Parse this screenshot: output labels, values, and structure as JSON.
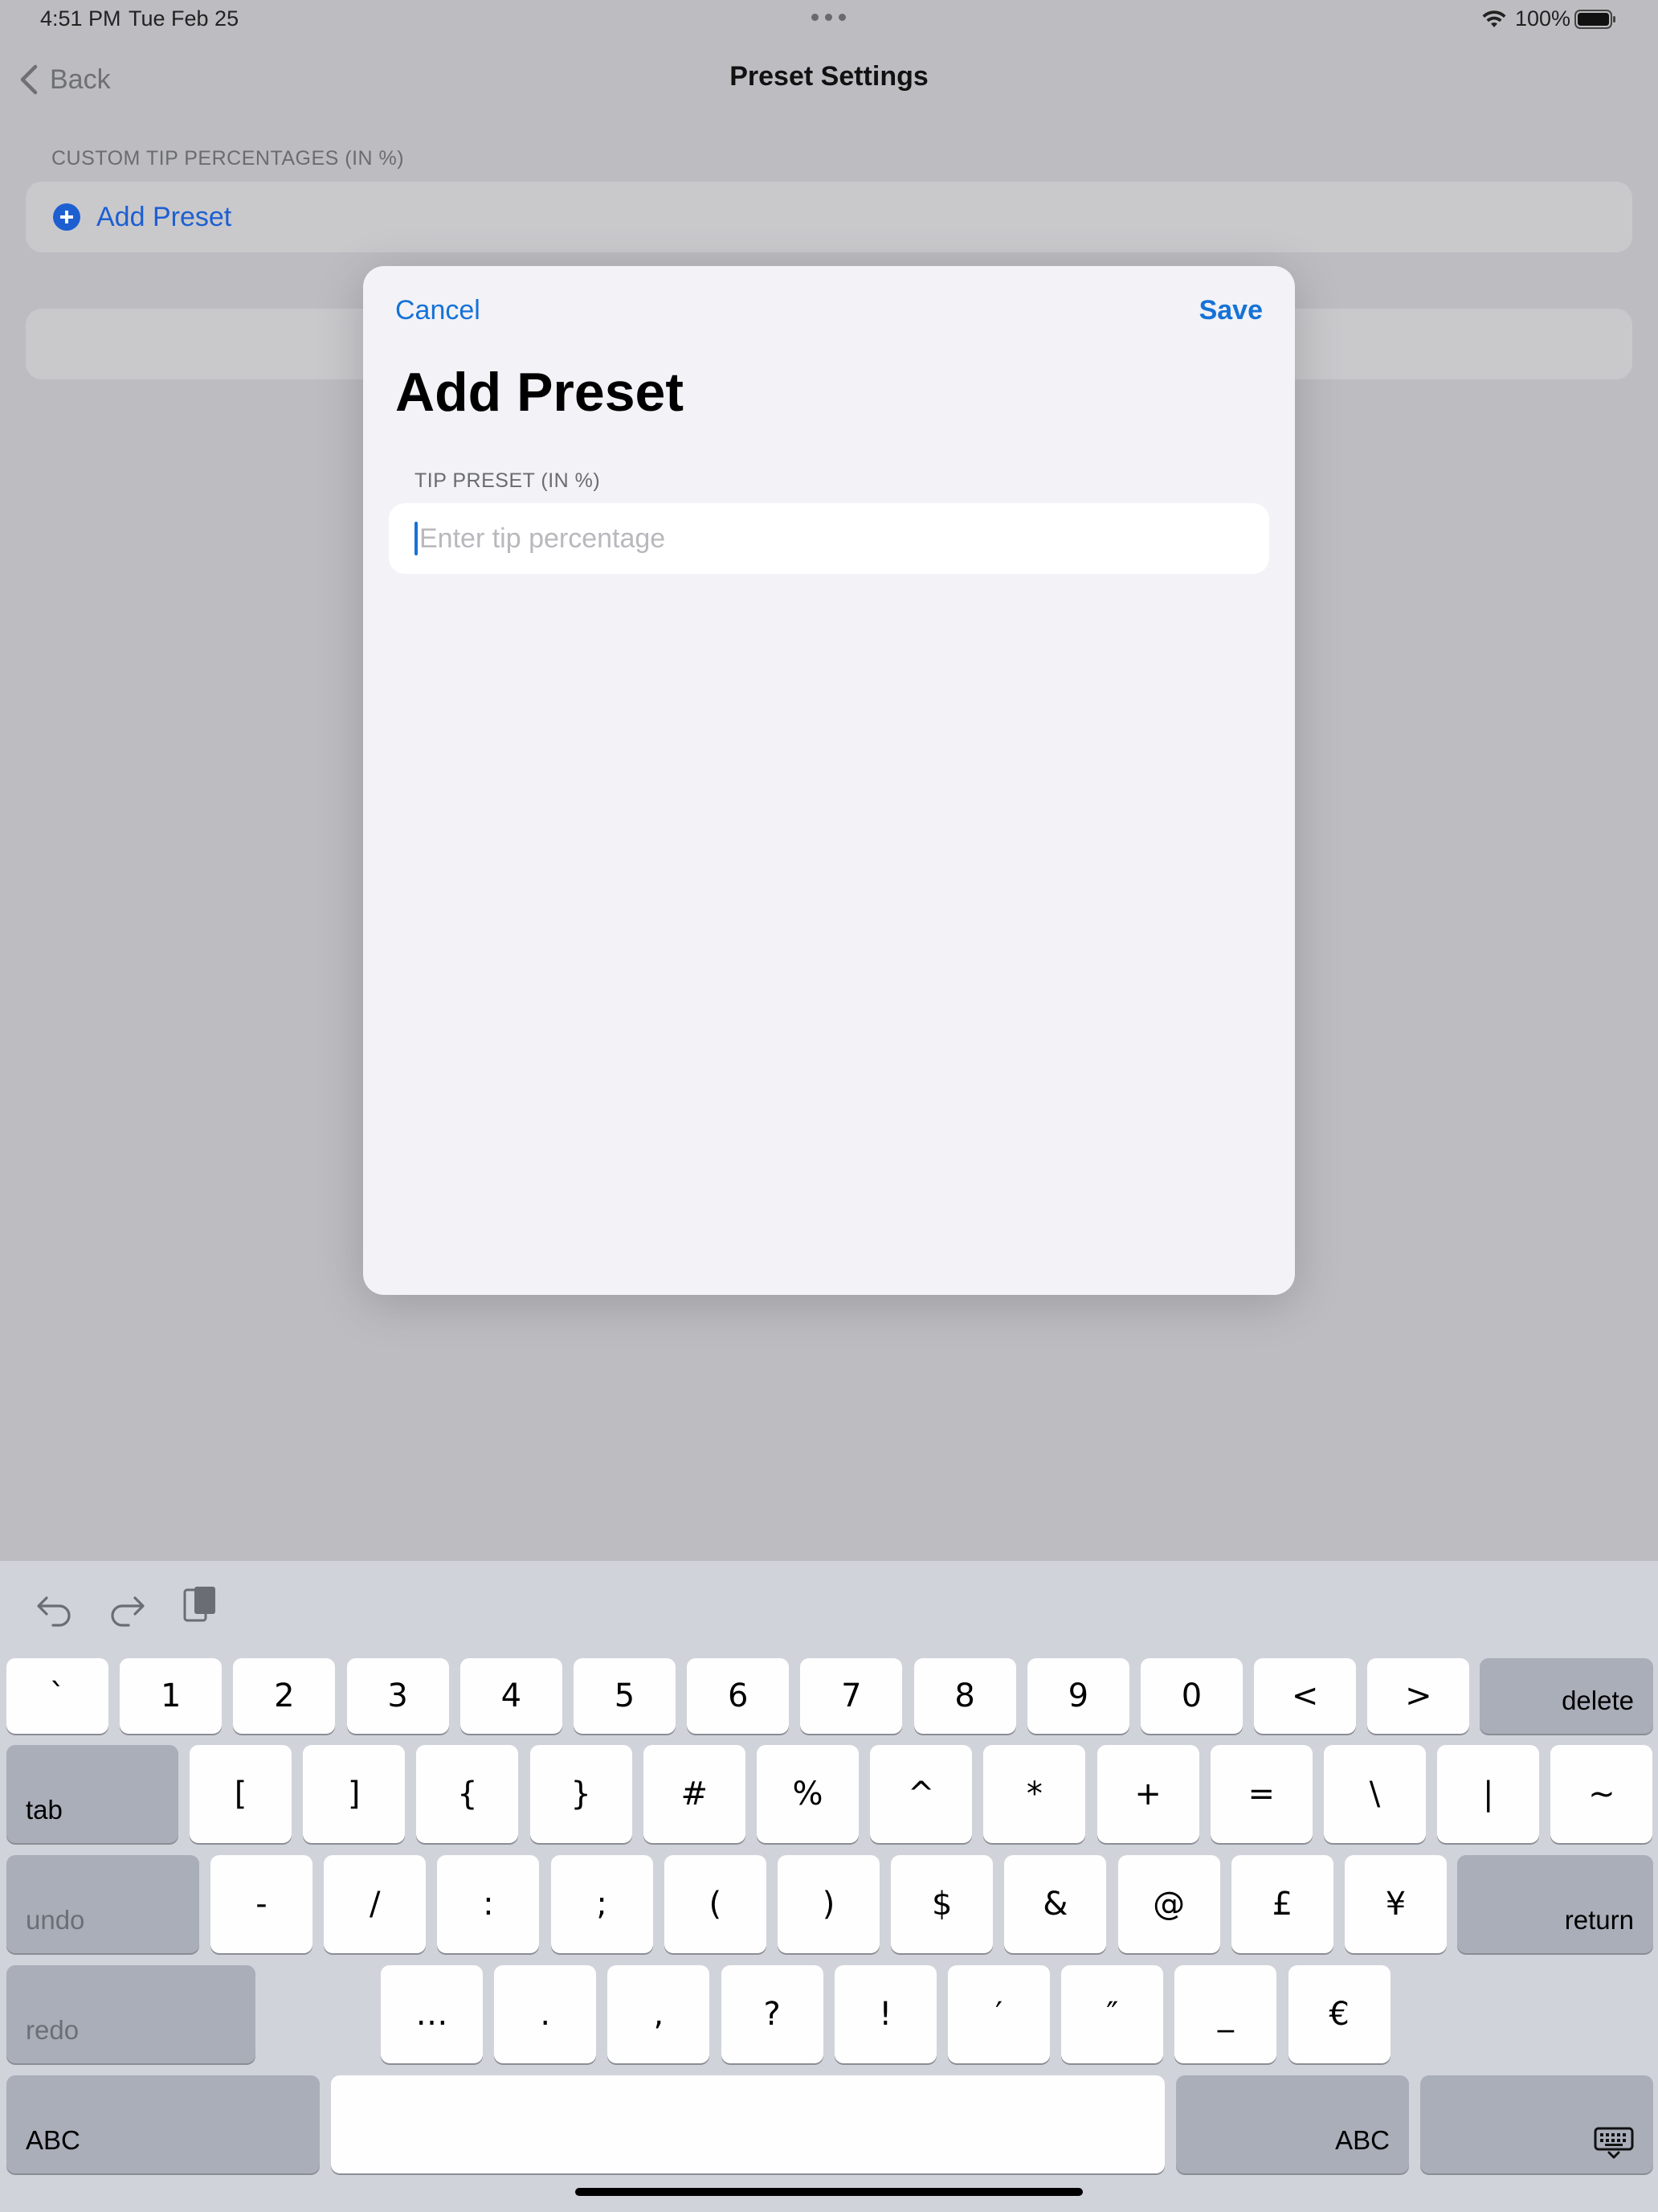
{
  "status_bar": {
    "time": "4:51 PM",
    "date": "Tue Feb 25",
    "battery_percent": "100%",
    "battery_level": 1.0
  },
  "nav": {
    "back_label": "Back",
    "title": "Preset Settings"
  },
  "list": {
    "section_header": "CUSTOM TIP PERCENTAGES (IN %)",
    "add_preset_label": "Add Preset"
  },
  "modal": {
    "cancel_label": "Cancel",
    "save_label": "Save",
    "title": "Add Preset",
    "field_header": "TIP PRESET (IN %)",
    "field_value": "",
    "field_placeholder": "Enter tip percentage"
  },
  "keyboard": {
    "toolbar_icons": [
      "undo-icon",
      "redo-icon",
      "paste-icon"
    ],
    "row1": [
      "`",
      "1",
      "2",
      "3",
      "4",
      "5",
      "6",
      "7",
      "8",
      "9",
      "0",
      "<",
      ">"
    ],
    "delete_label": "delete",
    "tab_label": "tab",
    "row2": [
      "[",
      "]",
      "{",
      "}",
      "#",
      "%",
      "^",
      "*",
      "+",
      "=",
      "\\",
      "|",
      "~"
    ],
    "undo_label": "undo",
    "row3": [
      "-",
      "/",
      ":",
      ";",
      "(",
      ")",
      "$",
      "&",
      "@",
      "£",
      "¥"
    ],
    "return_label": "return",
    "redo_label": "redo",
    "row4": [
      "…",
      ".",
      ",",
      "?",
      "!",
      "′",
      "″",
      "_",
      "€"
    ],
    "abc_left_label": "ABC",
    "abc_right_label": "ABC",
    "dismiss_icon": "keyboard-dismiss-icon"
  },
  "colors": {
    "accent": "#1672d6",
    "background_dimmed": "#bdbdc1",
    "modal_background": "#f2f2f7",
    "keyboard_background": "#d0d3da"
  }
}
